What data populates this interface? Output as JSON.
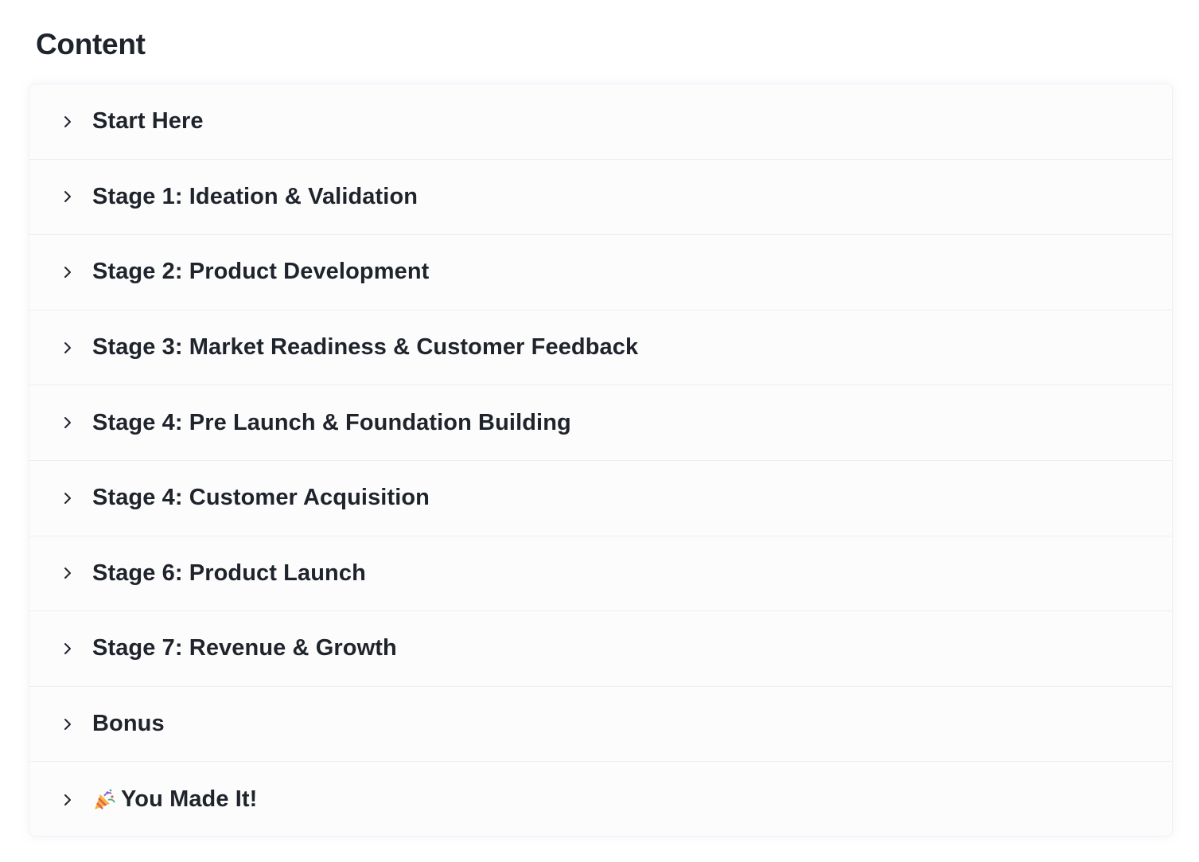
{
  "header": {
    "title": "Content"
  },
  "modules": [
    {
      "label": "Start Here",
      "icon": "chevron-right-icon"
    },
    {
      "label": "Stage 1: Ideation & Validation",
      "icon": "chevron-right-icon"
    },
    {
      "label": "Stage 2: Product Development",
      "icon": "chevron-right-icon"
    },
    {
      "label": "Stage 3: Market Readiness & Customer Feedback",
      "icon": "chevron-right-icon"
    },
    {
      "label": "Stage 4: Pre Launch & Foundation Building",
      "icon": "chevron-right-icon"
    },
    {
      "label": "Stage 4: Customer Acquisition",
      "icon": "chevron-right-icon"
    },
    {
      "label": "Stage 6: Product Launch",
      "icon": "chevron-right-icon"
    },
    {
      "label": "Stage 7: Revenue & Growth",
      "icon": "chevron-right-icon"
    },
    {
      "label": "Bonus",
      "icon": "chevron-right-icon"
    },
    {
      "label": "You Made It!",
      "icon": "chevron-right-icon",
      "emoji": "party-popper-icon"
    }
  ],
  "colors": {
    "text": "#1f232b",
    "border": "#eceef2",
    "panel_background": "#fcfcfd"
  }
}
